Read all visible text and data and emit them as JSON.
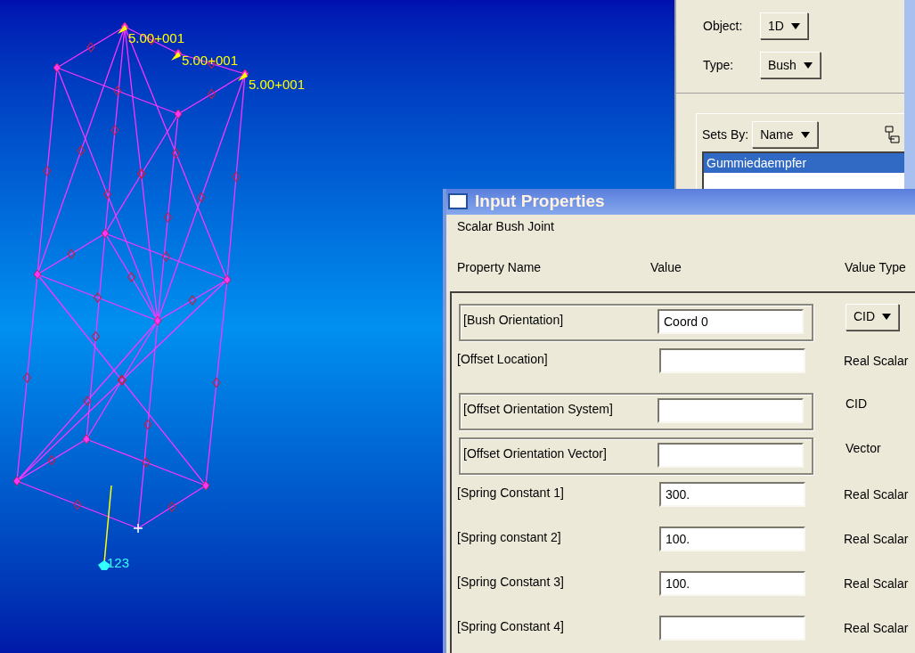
{
  "viewport": {
    "load_labels": [
      "5.00+001",
      "5.00+001",
      "5.00+001"
    ],
    "node_label": "123"
  },
  "side_panel": {
    "fields": [
      {
        "label": "Object:",
        "value": "1D"
      },
      {
        "label": "Type:",
        "value": "Bush"
      }
    ],
    "sets_by": {
      "label": "Sets By:",
      "value": "Name"
    },
    "sets": [
      {
        "name": "Gummiedaempfer",
        "selected": true
      }
    ]
  },
  "dialog": {
    "title": "Input Properties",
    "subtitle": "Scalar Bush Joint",
    "columns": [
      "Property Name",
      "Value",
      "Value Type"
    ],
    "rows": [
      {
        "name": "[Bush Orientation]",
        "value": "Coord 0",
        "value_type": "CID",
        "kind": "dropdown",
        "framed": true
      },
      {
        "name": "[Offset Location]",
        "value": "",
        "value_type": "Real Scalar",
        "kind": "text",
        "framed": false
      },
      {
        "name": "[Offset Orientation System]",
        "value": "",
        "value_type": "CID",
        "kind": "text",
        "framed": true
      },
      {
        "name": "[Offset Orientation Vector]",
        "value": "",
        "value_type": "Vector",
        "kind": "text",
        "framed": true
      },
      {
        "name": "[Spring Constant 1]",
        "value": "300.",
        "value_type": "Real Scalar",
        "kind": "text",
        "framed": false
      },
      {
        "name": "[Spring constant 2]",
        "value": "100.",
        "value_type": "Real Scalar",
        "kind": "text",
        "framed": false
      },
      {
        "name": "[Spring Constant 3]",
        "value": "100.",
        "value_type": "Real Scalar",
        "kind": "text",
        "framed": false
      },
      {
        "name": "[Spring Constant 4]",
        "value": "",
        "value_type": "Real Scalar",
        "kind": "text",
        "framed": false
      }
    ]
  }
}
